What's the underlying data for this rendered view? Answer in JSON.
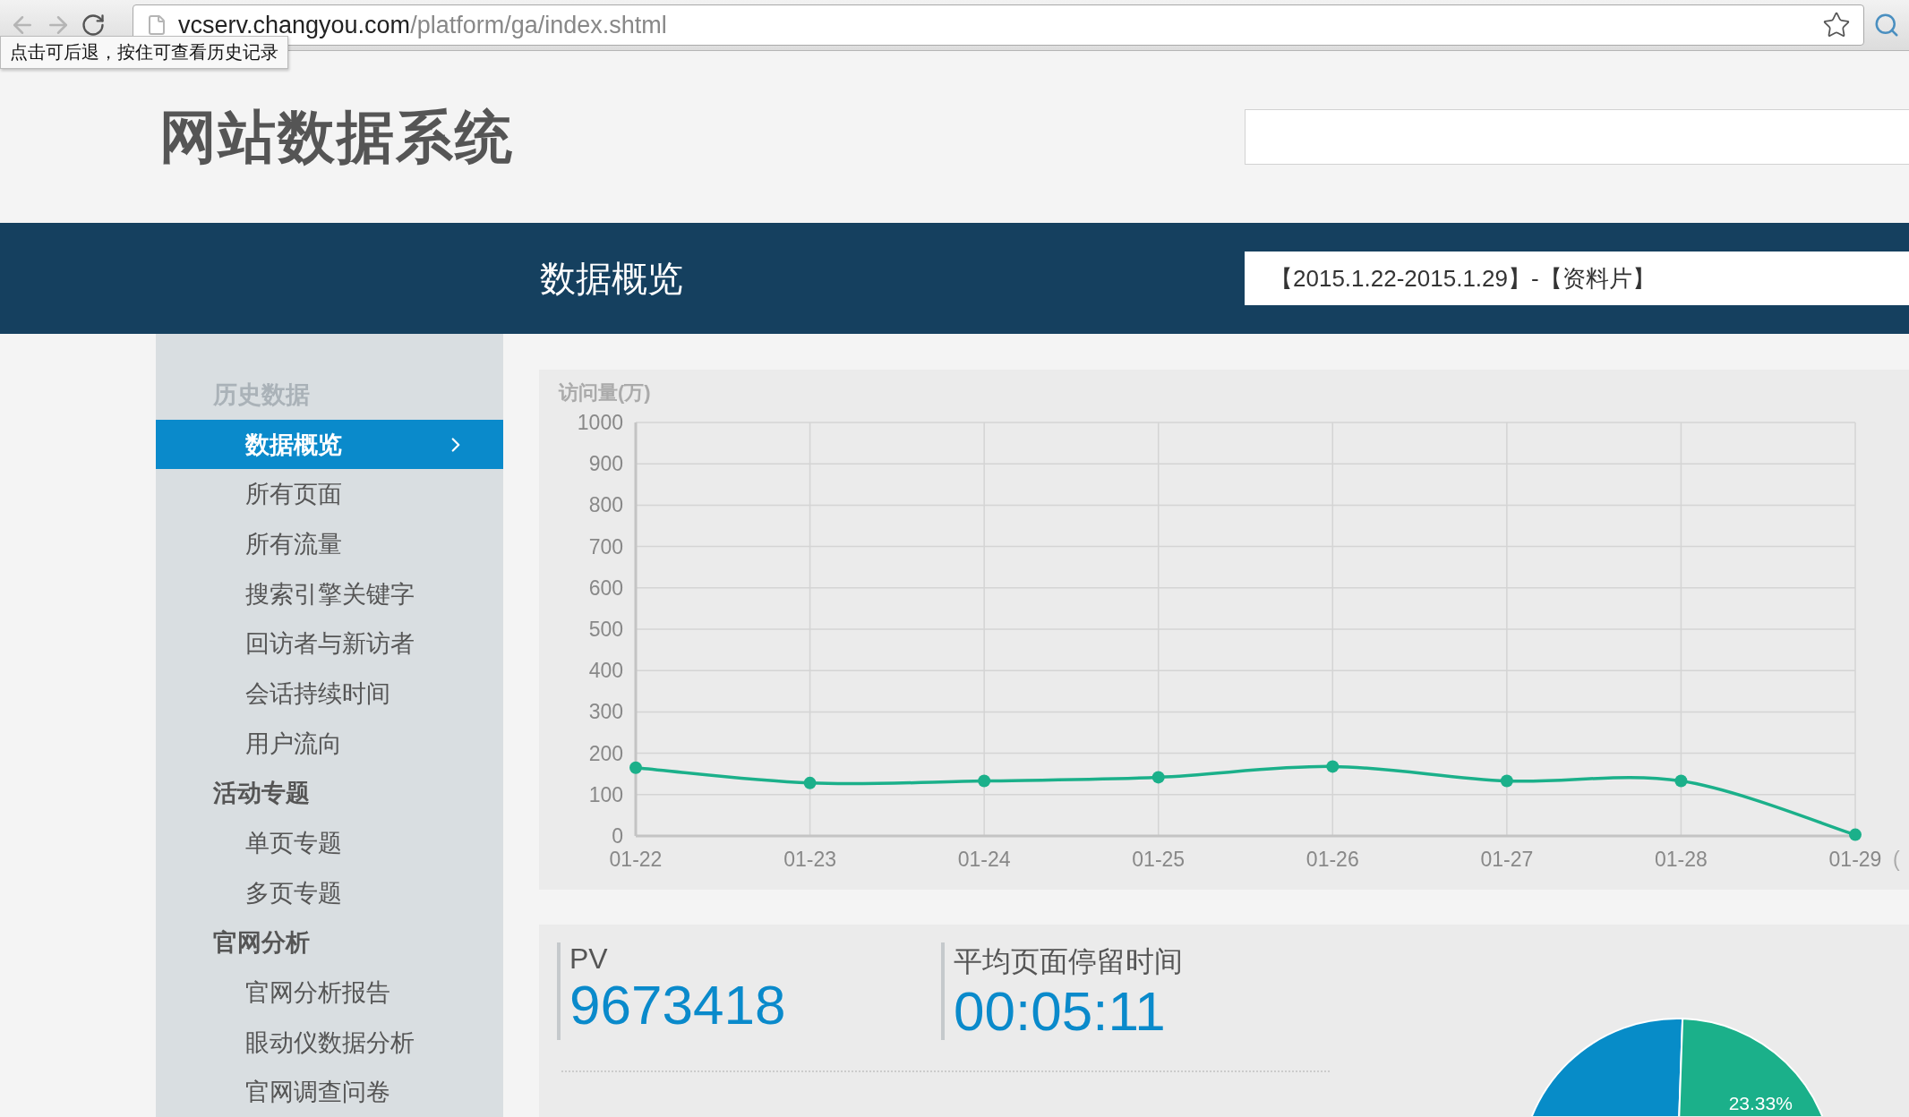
{
  "browser": {
    "url": {
      "host": "vcserv.changyou.com",
      "path": "/platform/ga/index.shtml"
    },
    "tooltip": "点击可后退，按住可查看历史记录"
  },
  "header": {
    "title": "网站数据系统"
  },
  "banner": {
    "title": "数据概览",
    "date_range": "【2015.1.22-2015.1.29】-【资料片】"
  },
  "sidebar": {
    "groups": [
      {
        "label": "历史数据",
        "dimmed": true,
        "children": [
          {
            "label": "数据概览",
            "selected": true
          },
          {
            "label": "所有页面",
            "selected": false
          },
          {
            "label": "所有流量",
            "selected": false
          },
          {
            "label": "搜索引擎关键字",
            "selected": false
          },
          {
            "label": "回访者与新访者",
            "selected": false
          },
          {
            "label": "会话持续时间",
            "selected": false
          },
          {
            "label": "用户流向",
            "selected": false
          }
        ]
      },
      {
        "label": "活动专题",
        "dimmed": false,
        "children": [
          {
            "label": "单页专题",
            "selected": false
          },
          {
            "label": "多页专题",
            "selected": false
          }
        ]
      },
      {
        "label": "官网分析",
        "dimmed": false,
        "children": [
          {
            "label": "官网分析报告",
            "selected": false
          },
          {
            "label": "眼动仪数据分析",
            "selected": false
          },
          {
            "label": "官网调查问卷",
            "selected": false
          }
        ]
      }
    ]
  },
  "visits_chart": {
    "chart_data": {
      "type": "line",
      "ylabel": "访问量(万)",
      "xlabel": "(",
      "categories": [
        "01-22",
        "01-23",
        "01-24",
        "01-25",
        "01-26",
        "01-27",
        "01-28",
        "01-29"
      ],
      "grid": true,
      "series": [
        {
          "color": "#1bb08a",
          "marker": true,
          "values": [
            165,
            128,
            133,
            142,
            168,
            133,
            133,
            3
          ]
        }
      ],
      "ylim": [
        0,
        1000
      ],
      "yticks": [
        0,
        100,
        200,
        300,
        400,
        500,
        600,
        700,
        800,
        900,
        1000
      ]
    }
  },
  "stats": [
    {
      "label": "PV",
      "value": "9673418"
    },
    {
      "label": "平均页面停留时间",
      "value": "00:05:11"
    }
  ],
  "share_chart": {
    "chart_data": {
      "type": "pie",
      "values": [
        76.67,
        23.33
      ],
      "colors": [
        "#078cc8",
        "#1bb08a"
      ],
      "value_labels": [
        null,
        "23.33%"
      ]
    }
  }
}
